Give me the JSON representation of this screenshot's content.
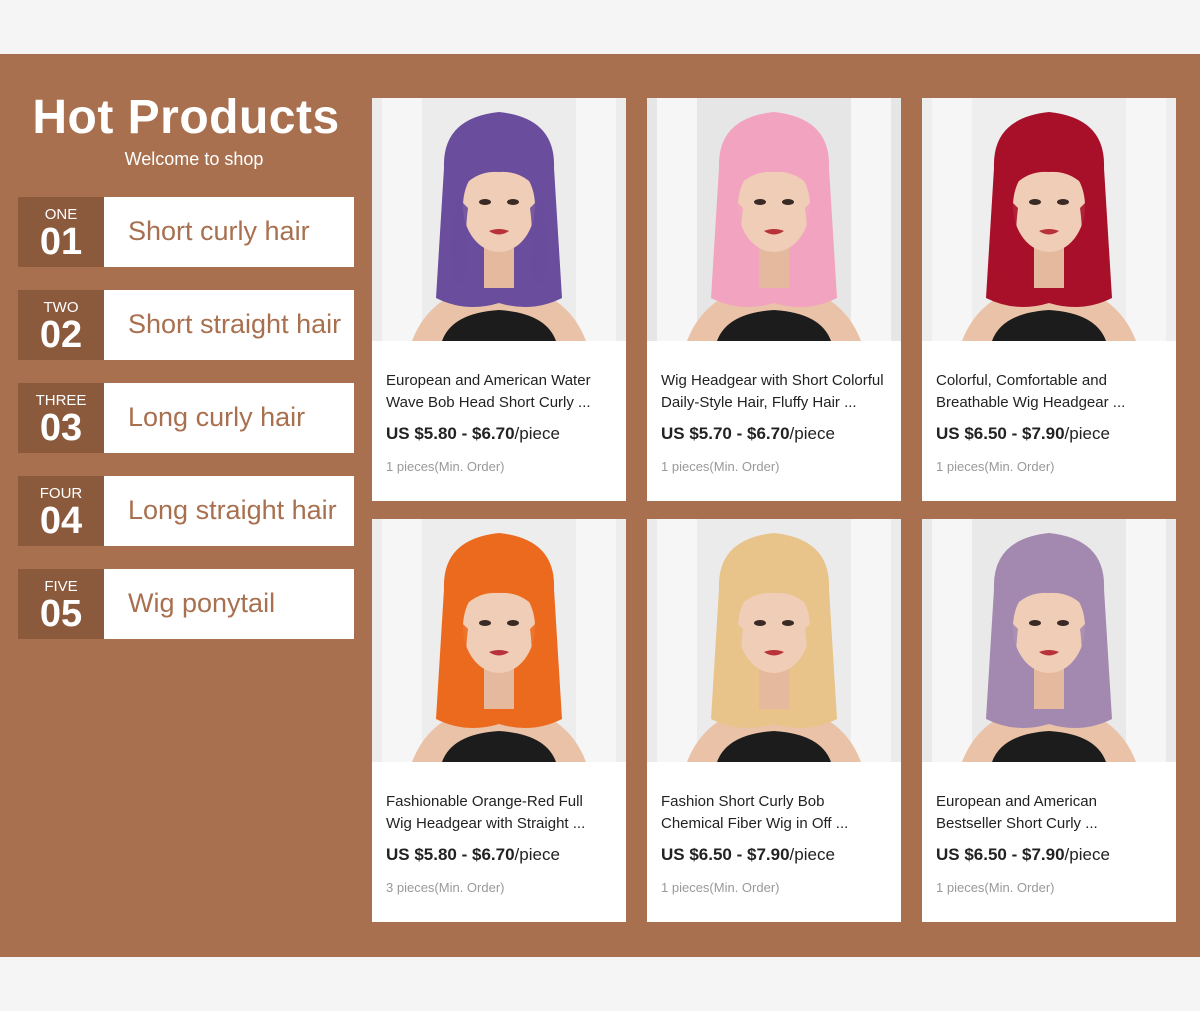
{
  "hero": {
    "title": "Hot Products",
    "subtitle": "Welcome to shop"
  },
  "categories": [
    {
      "word": "ONE",
      "digits": "01",
      "label": "Short curly hair"
    },
    {
      "word": "TWO",
      "digits": "02",
      "label": "Short straight hair"
    },
    {
      "word": "THREE",
      "digits": "03",
      "label": "Long curly hair"
    },
    {
      "word": "FOUR",
      "digits": "04",
      "label": "Long straight hair"
    },
    {
      "word": "FIVE",
      "digits": "05",
      "label": "Wig ponytail"
    }
  ],
  "products": [
    {
      "name": "European and American Water\nWave Bob Head Short Curly ...",
      "price": "US $5.80 - $6.70",
      "unit": "/piece",
      "moq": "1 pieces(Min. Order)",
      "hair_color": "#6a4d9c",
      "bg_color": "#ececec"
    },
    {
      "name": "Wig Headgear with Short Colorful\n Daily-Style Hair, Fluffy Hair ...",
      "price": "US $5.70 - $6.70",
      "unit": "/piece",
      "moq": "1  pieces(Min. Order)",
      "hair_color": "#f2a3c0",
      "bg_color": "#e6e6e6"
    },
    {
      "name": "Colorful, Comfortable and\nBreathable Wig Headgear ...",
      "price": "US $6.50 - $7.90",
      "unit": "/piece",
      "moq": "1  pieces(Min. Order)",
      "hair_color": "#a8102a",
      "bg_color": "#eeeeee"
    },
    {
      "name": "Fashionable Orange-Red Full\nWig Headgear with Straight ...",
      "price": "US $5.80 - $6.70",
      "unit": "/piece",
      "moq": "3 pieces(Min. Order)",
      "hair_color": "#ec6a1e",
      "bg_color": "#ededed"
    },
    {
      "name": "Fashion Short Curly Bob\nChemical Fiber Wig in Off ...",
      "price": "US $6.50 - $7.90",
      "unit": "/piece",
      "moq": "1 pieces(Min. Order)",
      "hair_color": "#e8c48a",
      "bg_color": "#ebebeb"
    },
    {
      "name": "European and American\nBestseller Short Curly ...",
      "price": "US $6.50 - $7.90",
      "unit": "/piece",
      "moq": "1 pieces(Min. Order)",
      "hair_color": "#a389b0",
      "bg_color": "#e9e9e9"
    }
  ]
}
